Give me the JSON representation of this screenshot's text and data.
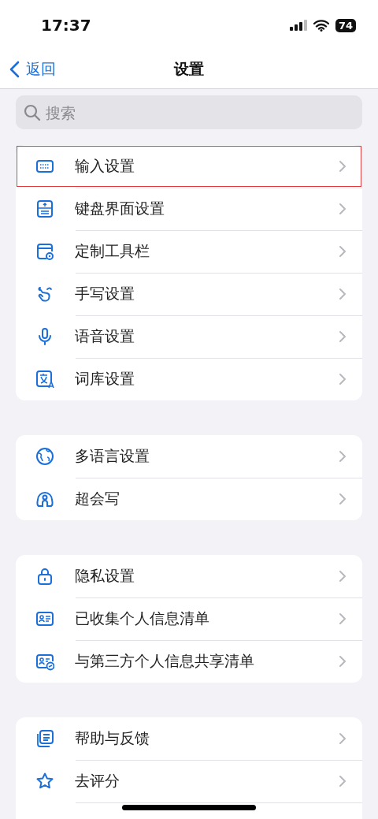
{
  "status_bar": {
    "time": "17:37",
    "battery": "74"
  },
  "nav": {
    "back": "返回",
    "title": "设置"
  },
  "search": {
    "placeholder": "搜索"
  },
  "groups": [
    {
      "items": [
        {
          "label": "输入设置",
          "highlighted": true
        },
        {
          "label": "键盘界面设置",
          "highlighted": false
        },
        {
          "label": "定制工具栏",
          "highlighted": false
        },
        {
          "label": "手写设置",
          "highlighted": false
        },
        {
          "label": "语音设置",
          "highlighted": false
        },
        {
          "label": "词库设置",
          "highlighted": false
        }
      ]
    },
    {
      "items": [
        {
          "label": "多语言设置",
          "highlighted": false
        },
        {
          "label": "超会写",
          "highlighted": false
        }
      ]
    },
    {
      "items": [
        {
          "label": "隐私设置",
          "highlighted": false
        },
        {
          "label": "已收集个人信息清单",
          "highlighted": false
        },
        {
          "label": "与第三方个人信息共享清单",
          "highlighted": false
        }
      ]
    },
    {
      "items": [
        {
          "label": "帮助与反馈",
          "highlighted": false
        },
        {
          "label": "去评分",
          "highlighted": false
        }
      ]
    }
  ]
}
